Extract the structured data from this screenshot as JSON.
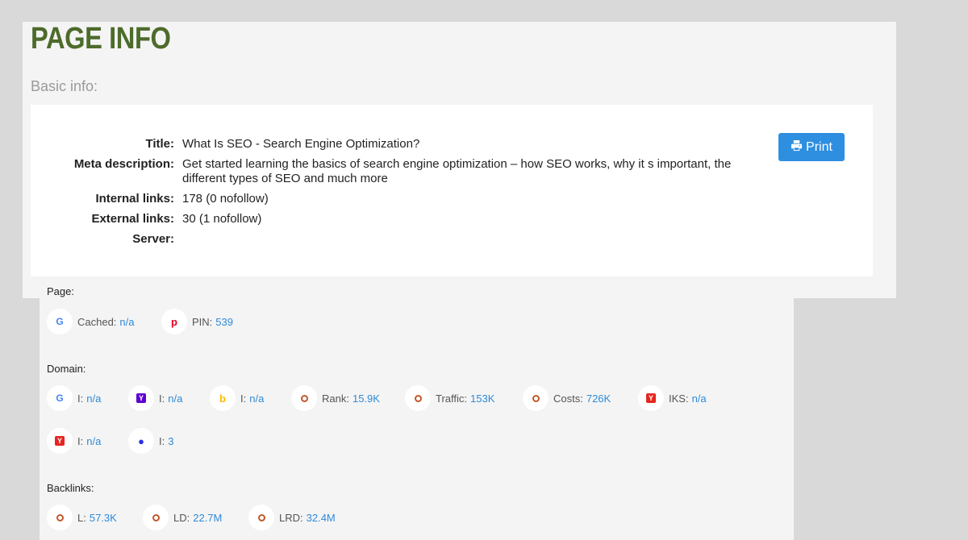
{
  "header": {
    "title": "PAGE INFO",
    "section": "Basic info:"
  },
  "basic_info": [
    {
      "label": "Title:",
      "value": "What Is SEO - Search Engine Optimization?"
    },
    {
      "label": "Meta description:",
      "value": "Get started learning the basics of search engine optimization – how SEO works, why it s important, the different types of SEO and much more"
    },
    {
      "label": "Internal links:",
      "value": "178 (0 nofollow)"
    },
    {
      "label": "External links:",
      "value": "30 (1 nofollow)"
    },
    {
      "label": "Server:",
      "value": ""
    }
  ],
  "print_label": "Print",
  "page_group": {
    "label": "Page:",
    "items": [
      {
        "icon": "google-icon",
        "label": "Cached:",
        "value": "n/a"
      },
      {
        "icon": "pinterest-icon",
        "label": "PIN:",
        "value": "539"
      }
    ]
  },
  "domain_group": {
    "label": "Domain:",
    "items": [
      {
        "icon": "google-icon",
        "label": "I:",
        "value": "n/a"
      },
      {
        "icon": "yahoo-icon",
        "label": "I:",
        "value": "n/a"
      },
      {
        "icon": "bing-icon",
        "label": "I:",
        "value": "n/a"
      },
      {
        "icon": "semrush-icon",
        "label": "Rank:",
        "value": "15.9K"
      },
      {
        "icon": "semrush-icon",
        "label": "Traffic:",
        "value": "153K"
      },
      {
        "icon": "semrush-icon",
        "label": "Costs:",
        "value": "726K"
      },
      {
        "icon": "yandex-icon",
        "label": "IKS:",
        "value": "n/a"
      },
      {
        "icon": "yandex-icon",
        "label": "I:",
        "value": "n/a"
      },
      {
        "icon": "baidu-icon",
        "label": "I:",
        "value": "3"
      }
    ]
  },
  "backlinks_group": {
    "label": "Backlinks:",
    "items": [
      {
        "icon": "semrush-icon",
        "label": "L:",
        "value": "57.3K"
      },
      {
        "icon": "semrush-icon",
        "label": "LD:",
        "value": "22.7M"
      },
      {
        "icon": "semrush-icon",
        "label": "LRD:",
        "value": "32.4M"
      }
    ]
  },
  "colors": {
    "title": "#4d6b2b",
    "accent": "#2e8ee0",
    "link_value": "#2f8ad8"
  }
}
